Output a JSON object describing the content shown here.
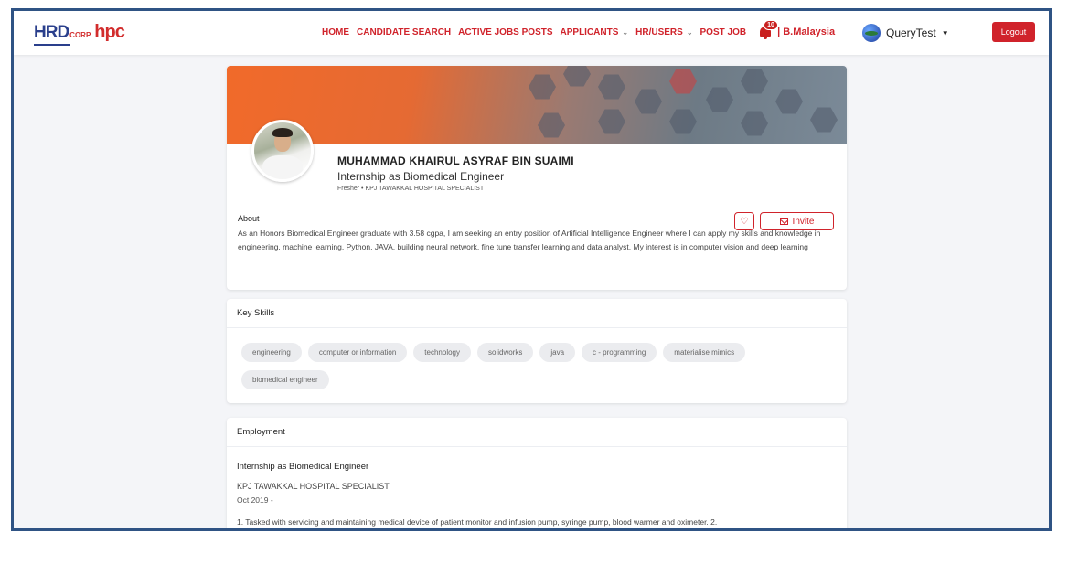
{
  "brand": {
    "hrd": "HRD",
    "corp": "CORP",
    "hpc": "hpc"
  },
  "nav": {
    "items": [
      {
        "label": "HOME"
      },
      {
        "label": "CANDIDATE SEARCH"
      },
      {
        "label": "ACTIVE JOBS POSTS"
      },
      {
        "label": "APPLICANTS",
        "dropdown": true
      },
      {
        "label": "HR/USERS",
        "dropdown": true
      },
      {
        "label": "POST JOB"
      }
    ],
    "notification_count": "10",
    "country": "| B.Malaysia"
  },
  "user": {
    "name": "QueryTest"
  },
  "logout_label": "Logout",
  "profile": {
    "name": "MUHAMMAD KHAIRUL ASYRAF BIN SUAIMI",
    "title": "Internship as Biomedical Engineer",
    "subtitle": "Fresher • KPJ TAWAKKAL HOSPITAL SPECIALIST",
    "about_label": "About",
    "about_text": "As an Honors Biomedical Engineer graduate with 3.58 cgpa, I am seeking an entry position of Artificial Intelligence Engineer where I can apply my skills and knowledge in engineering, machine learning, Python, JAVA, building neural network, fine tune transfer learning and data analyst. My interest is in computer vision and deep learning",
    "invite_label": "Invite"
  },
  "skills": {
    "header": "Key Skills",
    "items": [
      "engineering",
      "computer or information",
      "technology",
      "solidworks",
      "java",
      "c - programming",
      "materialise mimics",
      "biomedical engineer"
    ]
  },
  "employment": {
    "header": "Employment",
    "title": "Internship as Biomedical Engineer",
    "company": "KPJ TAWAKKAL HOSPITAL SPECIALIST",
    "date": "Oct 2019 -",
    "description": "1. Tasked with servicing and maintaining medical device of patient monitor and infusion pump, syringe pump, blood warmer and oximeter. 2."
  },
  "colors": {
    "accent": "#d0232b",
    "brand_blue": "#2a3f8c",
    "frame": "#2f5384"
  }
}
